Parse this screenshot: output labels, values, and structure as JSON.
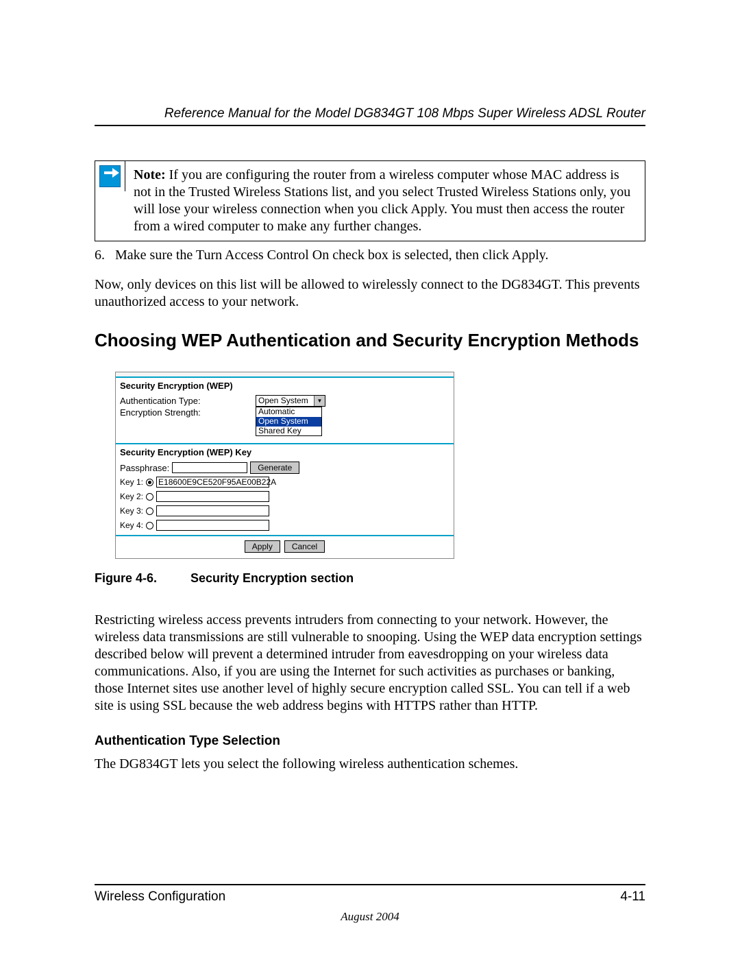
{
  "header": {
    "running_title": "Reference Manual for the Model DG834GT 108 Mbps Super Wireless ADSL Router"
  },
  "note": {
    "label": "Note:",
    "body": " If you are configuring the router from a wireless computer whose MAC address is not in the Trusted Wireless Stations list, and you select Trusted Wireless Stations only, you will lose your wireless connection when you click Apply. You must then access the router from a wired computer to make any further changes."
  },
  "step6": {
    "num": "6.",
    "text": "Make sure the Turn Access Control On check box is selected, then click Apply."
  },
  "para_after_step": "Now, only devices on this list will be allowed to wirelessly connect to the DG834GT. This prevents unauthorized access to your network.",
  "section_heading": "Choosing WEP Authentication and Security Encryption Methods",
  "screenshot": {
    "section1_title": "Security Encryption (WEP)",
    "auth_type_label": "Authentication Type:",
    "auth_type_selected": "Open System",
    "enc_strength_label": "Encryption Strength:",
    "enc_options": {
      "opt1": "Automatic",
      "opt2": "Open System",
      "opt3": "Shared Key"
    },
    "section2_title": "Security Encryption (WEP) Key",
    "passphrase_label": "Passphrase:",
    "generate_btn": "Generate",
    "key1_label": "Key 1:",
    "key1_value": "E18600E9CE520F95AE00B22A",
    "key2_label": "Key 2:",
    "key3_label": "Key 3:",
    "key4_label": "Key 4:",
    "apply_btn": "Apply",
    "cancel_btn": "Cancel"
  },
  "figure_caption": {
    "label": "Figure 4-6.",
    "title": "Security Encryption section"
  },
  "para_restrict": "Restricting wireless access prevents intruders from connecting to your network. However, the wireless data transmissions are still vulnerable to snooping. Using the WEP data encryption settings described below will prevent a determined intruder from eavesdropping on your wireless data communications. Also, if you are using the Internet for such activities as purchases or banking, those Internet sites use another level of highly secure encryption called SSL. You can tell if a web site is using SSL because the web address begins with HTTPS rather than HTTP.",
  "subheading": "Authentication Type Selection",
  "para_sub": "The DG834GT lets you select the following wireless authentication schemes.",
  "footer": {
    "left": "Wireless Configuration",
    "right": "4-11",
    "date": "August 2004"
  }
}
